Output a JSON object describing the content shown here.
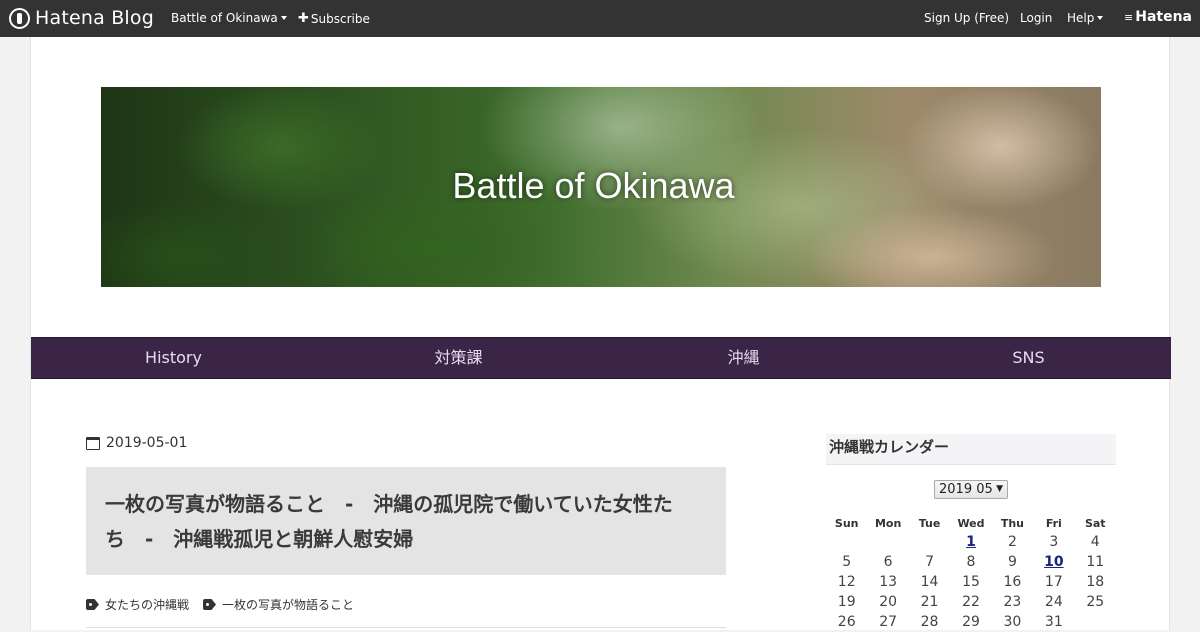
{
  "globalbar": {
    "logo_text": "Hatena Blog",
    "blog_menu": "Battle of Okinawa",
    "subscribe": "Subscribe",
    "signup": "Sign Up (Free)",
    "login": "Login",
    "help": "Help",
    "brand": "Hatena"
  },
  "header": {
    "title": "Battle of Okinawa"
  },
  "nav": {
    "items": [
      "History",
      "対策課",
      "沖縄",
      "SNS"
    ]
  },
  "article": {
    "date": "2019-05-01",
    "title": "一枚の写真が物語ること　-　沖縄の孤児院で働いていた女性たち　-　沖縄戦孤児と朝鮮人慰安婦",
    "tags": [
      "女たちの沖縄戦",
      "一枚の写真が物語ること"
    ]
  },
  "sidebar": {
    "heading": "沖縄戦カレンダー",
    "month_select": "2019 05",
    "weekdays": [
      "Sun",
      "Mon",
      "Tue",
      "Wed",
      "Thu",
      "Fri",
      "Sat"
    ],
    "weeks": [
      [
        "",
        "",
        "",
        "1",
        "2",
        "3",
        "4"
      ],
      [
        "5",
        "6",
        "7",
        "8",
        "9",
        "10",
        "11"
      ],
      [
        "12",
        "13",
        "14",
        "15",
        "16",
        "17",
        "18"
      ],
      [
        "19",
        "20",
        "21",
        "22",
        "23",
        "24",
        "25"
      ],
      [
        "26",
        "27",
        "28",
        "29",
        "30",
        "31",
        ""
      ]
    ],
    "linked_days": [
      "1",
      "10"
    ]
  }
}
